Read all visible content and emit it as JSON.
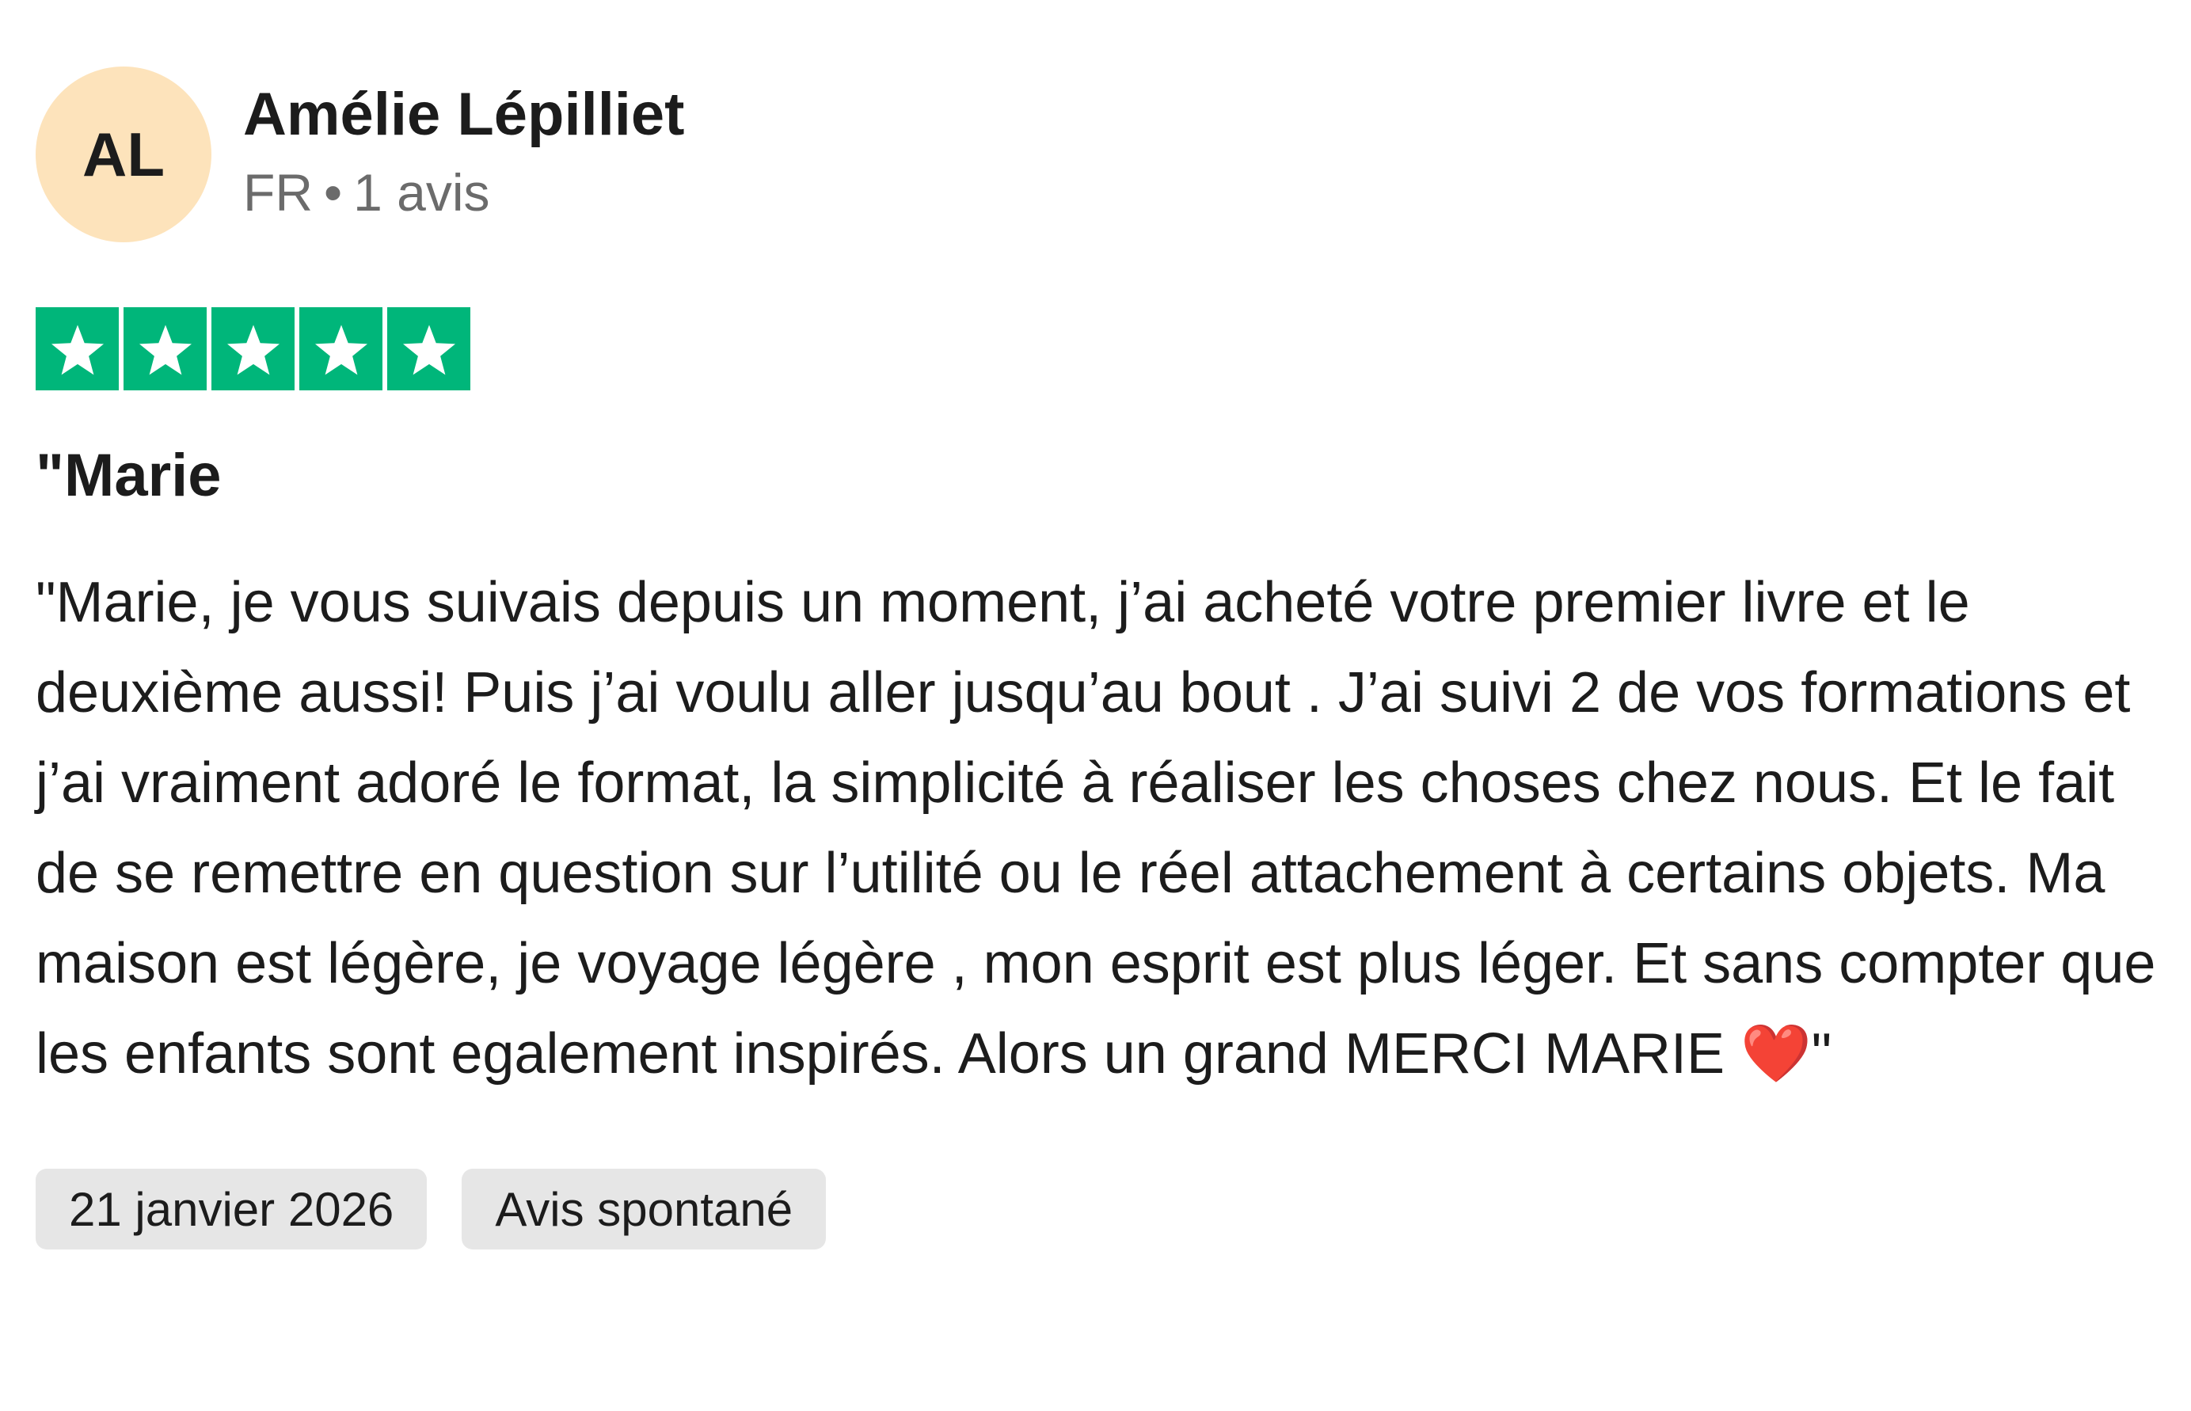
{
  "reviewer": {
    "initials": "AL",
    "name": "Amélie Lépilliet",
    "country": "FR",
    "separator": "•",
    "review_count": "1 avis",
    "avatar_color": "#fde3bb"
  },
  "rating": {
    "stars": 5,
    "max": 5,
    "color": "#00b67a",
    "icon": "star-icon"
  },
  "review": {
    "title": "\"Marie",
    "body": "\"Marie, je vous suivais depuis un moment, j’ai acheté votre premier livre et le deuxième aussi! Puis j’ai voulu aller jusqu’au bout . J’ai suivi 2 de vos formations et j’ai vraiment adoré le format, la simplicité à réaliser les choses chez nous. Et le fait de se remettre en question sur l’utilité ou le réel attachement à certains objets. Ma maison est légère, je voyage légère , mon esprit est plus léger. Et sans compter que les enfants sont egalement inspirés. Alors un grand MERCI MARIE ❤️\""
  },
  "tags": {
    "date": "21 janvier 2026",
    "type": "Avis spontané"
  }
}
